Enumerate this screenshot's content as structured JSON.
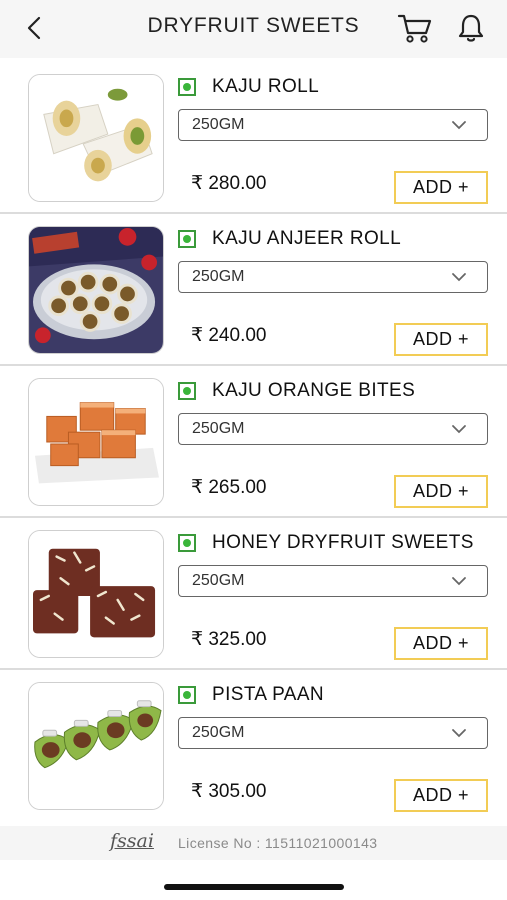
{
  "header": {
    "title": "DRYFRUIT SWEETS",
    "back_icon": "chevron-left-icon",
    "cart_icon": "cart-icon",
    "bell_icon": "bell-icon"
  },
  "products": [
    {
      "name": "KAJU ROLL",
      "weight": "250GM",
      "price": "₹ 280.00",
      "add_label": "ADD +",
      "image": "kaju-roll-image"
    },
    {
      "name": "KAJU ANJEER ROLL",
      "weight": "250GM",
      "price": "₹ 240.00",
      "add_label": "ADD +",
      "image": "kaju-anjeer-roll-image"
    },
    {
      "name": "KAJU ORANGE BITES",
      "weight": "250GM",
      "price": "₹ 265.00",
      "add_label": "ADD +",
      "image": "kaju-orange-bites-image"
    },
    {
      "name": "HONEY DRYFRUIT SWEETS",
      "weight": "250GM",
      "price": "₹ 325.00",
      "add_label": "ADD +",
      "image": "honey-dryfruit-sweets-image"
    },
    {
      "name": "PISTA PAAN",
      "weight": "250GM",
      "price": "₹ 305.00",
      "add_label": "ADD +",
      "image": "pista-paan-image"
    }
  ],
  "footer": {
    "fssai_logo": "fssai",
    "license": "License No : 11511021000143"
  },
  "colors": {
    "veg_mark": "#3ab53a",
    "add_button_border": "#f2cc55",
    "header_bg": "#f6f6f6"
  }
}
